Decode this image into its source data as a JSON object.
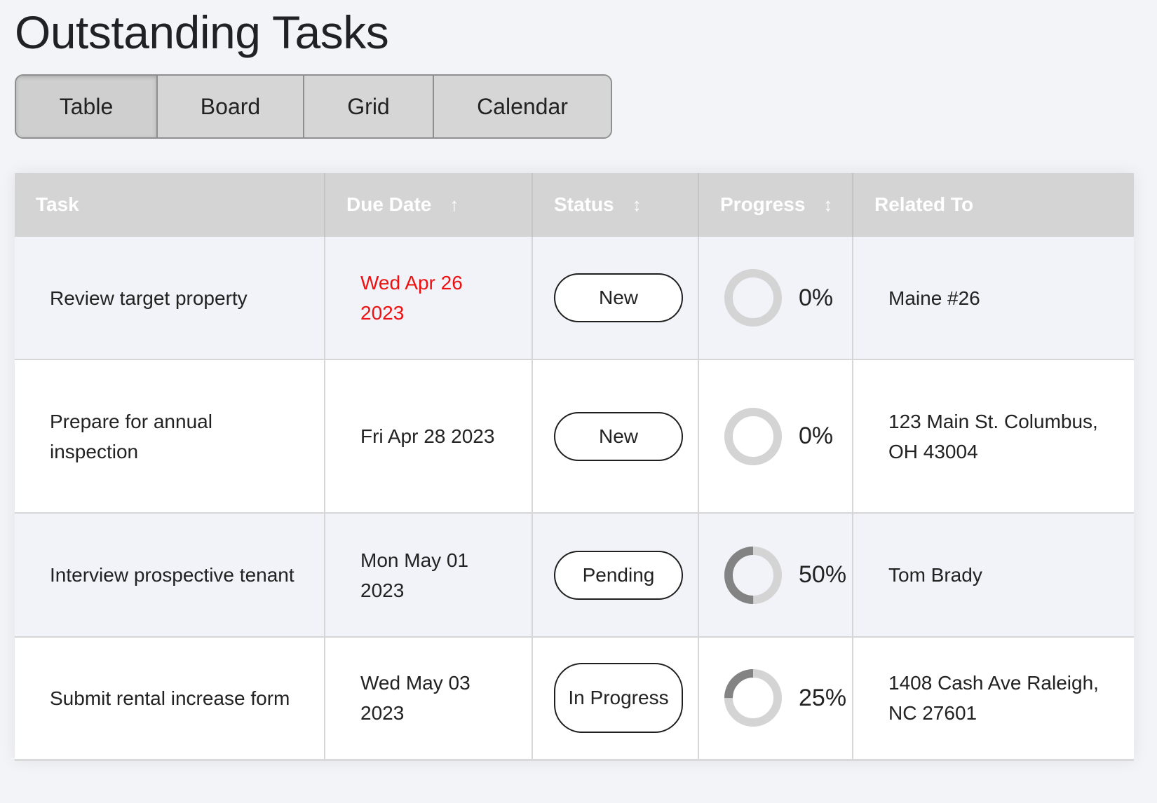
{
  "page": {
    "title": "Outstanding Tasks"
  },
  "view_tabs": [
    {
      "label": "Table",
      "active": true
    },
    {
      "label": "Board",
      "active": false
    },
    {
      "label": "Grid",
      "active": false
    },
    {
      "label": "Calendar",
      "active": false
    }
  ],
  "table": {
    "columns": [
      {
        "label": "Task",
        "sort": ""
      },
      {
        "label": "Due Date",
        "sort": "↑"
      },
      {
        "label": "Status",
        "sort": "↕"
      },
      {
        "label": "Progress",
        "sort": "↕"
      },
      {
        "label": "Related To",
        "sort": ""
      }
    ],
    "rows": [
      {
        "task": "Review target property",
        "due_date": "Wed Apr 26 2023",
        "overdue": true,
        "status": "New",
        "progress": 0,
        "progress_label": "0%",
        "related": "Maine #26"
      },
      {
        "task": "Prepare for annual inspection",
        "due_date": "Fri Apr 28 2023",
        "overdue": false,
        "status": "New",
        "progress": 0,
        "progress_label": "0%",
        "related": "123 Main St. Columbus, OH 43004"
      },
      {
        "task": "Interview prospective tenant",
        "due_date": "Mon May 01 2023",
        "overdue": false,
        "status": "Pending",
        "progress": 50,
        "progress_label": "50%",
        "related": "Tom Brady"
      },
      {
        "task": "Submit rental increase form",
        "due_date": "Wed May 03 2023",
        "overdue": false,
        "status": "In Progress",
        "progress": 25,
        "progress_label": "25%",
        "related": "1408 Cash Ave Raleigh, NC 27601"
      }
    ]
  },
  "colors": {
    "overdue": "#ee1111",
    "ring_track": "#d4d4d4",
    "ring_fill": "#838383",
    "header_bg": "#d4d4d4"
  }
}
